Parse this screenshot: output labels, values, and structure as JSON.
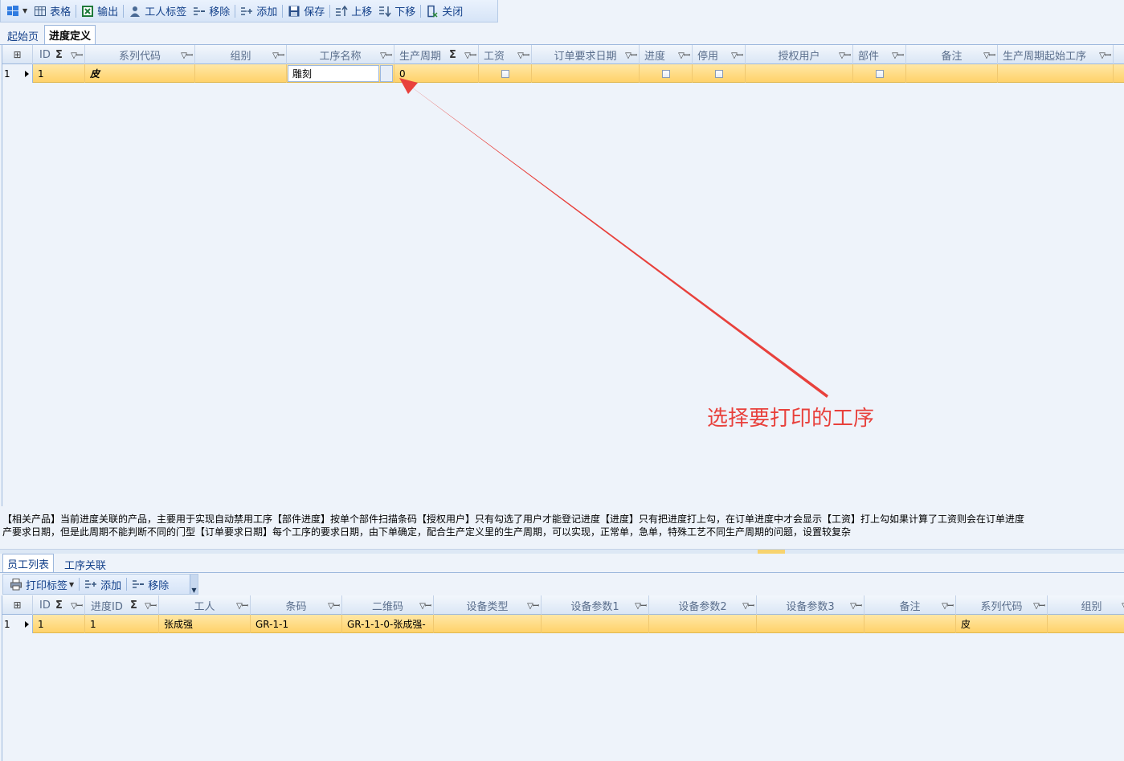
{
  "toolbar": {
    "items": [
      {
        "label": "表格",
        "icon": "table-icon"
      },
      {
        "label": "输出",
        "icon": "excel-icon"
      },
      {
        "label": "工人标签",
        "icon": "user-icon"
      },
      {
        "label": "移除",
        "icon": "remove-icon"
      },
      {
        "label": "添加",
        "icon": "add-icon"
      },
      {
        "label": "保存",
        "icon": "save-icon"
      },
      {
        "label": "上移",
        "icon": "move-up-icon"
      },
      {
        "label": "下移",
        "icon": "move-down-icon"
      },
      {
        "label": "关闭",
        "icon": "close-icon"
      }
    ]
  },
  "tabs_top": [
    {
      "label": "起始页"
    },
    {
      "label": "进度定义"
    }
  ],
  "grid1": {
    "columns": [
      {
        "label": "ID"
      },
      {
        "label": "系列代码"
      },
      {
        "label": "组别"
      },
      {
        "label": "工序名称"
      },
      {
        "label": "生产周期"
      },
      {
        "label": "工资"
      },
      {
        "label": "订单要求日期"
      },
      {
        "label": "进度"
      },
      {
        "label": "停用"
      },
      {
        "label": "授权用户"
      },
      {
        "label": "部件"
      },
      {
        "label": "备注"
      },
      {
        "label": "生产周期起始工序"
      }
    ],
    "row": {
      "row_number": "1",
      "id": "1",
      "series_code": "皮",
      "group": "",
      "process_name": "雕刻",
      "cycle": "0",
      "wage_checked": false,
      "order_date": "",
      "progress_checked": false,
      "disabled_checked": false,
      "auth_user": "",
      "part_checked": false,
      "remark": "",
      "cycle_start": ""
    }
  },
  "annotation": {
    "text": "选择要打印的工序",
    "color": "#e8413c"
  },
  "info": {
    "line1": "【相关产品】当前进度关联的产品，主要用于实现自动禁用工序【部件进度】按单个部件扫描条码【授权用户】只有勾选了用户才能登记进度【进度】只有把进度打上勾，在订单进度中才会显示【工资】打上勾如果计算了工资则会在订单进度",
    "line2": "产要求日期，但是此周期不能判断不同的门型【订单要求日期】每个工序的要求日期，由下单确定，配合生产定义里的生产周期，可以实现，正常单，急单，特殊工艺不同生产周期的问题，设置较复杂"
  },
  "tabs_bottom": [
    {
      "label": "员工列表"
    },
    {
      "label": "工序关联"
    }
  ],
  "toolbar2": {
    "print_label": "打印标签",
    "add_label": "添加",
    "remove_label": "移除"
  },
  "grid2": {
    "columns": [
      {
        "label": "ID"
      },
      {
        "label": "进度ID"
      },
      {
        "label": "工人"
      },
      {
        "label": "条码"
      },
      {
        "label": "二维码"
      },
      {
        "label": "设备类型"
      },
      {
        "label": "设备参数1"
      },
      {
        "label": "设备参数2"
      },
      {
        "label": "设备参数3"
      },
      {
        "label": "备注"
      },
      {
        "label": "系列代码"
      },
      {
        "label": "组别"
      }
    ],
    "row": {
      "row_number": "1",
      "id": "1",
      "progress_id": "1",
      "worker": "张成强",
      "barcode": "GR-1-1",
      "qrcode": "GR-1-1-0-张成强-",
      "device_type": "",
      "param1": "",
      "param2": "",
      "param3": "",
      "remark": "",
      "series_code": "皮",
      "group": ""
    }
  }
}
